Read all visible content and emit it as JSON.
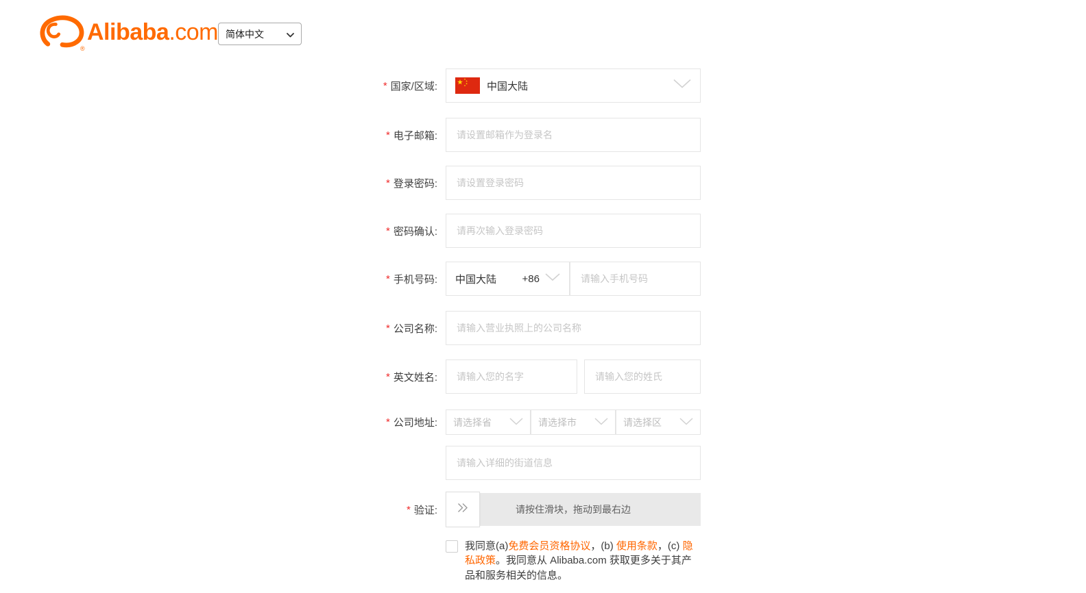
{
  "header": {
    "logo": {
      "brand": "Alibaba",
      "suffix": ".com",
      "registered_mark": "®"
    },
    "language_select": {
      "value": "简体中文"
    }
  },
  "form": {
    "required_marker": "*",
    "country": {
      "label": "国家/区域:",
      "value": "中国大陆"
    },
    "email": {
      "label": "电子邮箱:",
      "placeholder": "请设置邮箱作为登录名"
    },
    "password": {
      "label": "登录密码:",
      "placeholder": "请设置登录密码"
    },
    "password_confirm": {
      "label": "密码确认:",
      "placeholder": "请再次输入登录密码"
    },
    "phone": {
      "label": "手机号码:",
      "region": "中国大陆",
      "dial_code": "+86",
      "placeholder": "请输入手机号码"
    },
    "company_name": {
      "label": "公司名称:",
      "placeholder": "请输入营业执照上的公司名称"
    },
    "english_name": {
      "label": "英文姓名:",
      "first_name_placeholder": "请输入您的名字",
      "last_name_placeholder": "请输入您的姓氏"
    },
    "company_address": {
      "label": "公司地址:",
      "province_placeholder": "请选择省",
      "city_placeholder": "请选择市",
      "district_placeholder": "请选择区",
      "street_placeholder": "请输入详细的街道信息"
    },
    "captcha": {
      "label": "验证:",
      "instruction": "请按住滑块，拖动到最右边"
    },
    "agreement": {
      "part1": "我同意(a)",
      "membership_link": "免费会员资格协议",
      "part2": "，(b) ",
      "terms_link": "使用条款",
      "part3": "，(c) ",
      "privacy_link": "隐私政策",
      "part4": "。我同意从 Alibaba.com 获取更多关于其产品和服务相关的信息。"
    }
  },
  "icons": {
    "chevron_down": "⌄",
    "double_chevron_right": "»",
    "china_flag": "🇨🇳"
  },
  "colors": {
    "brand_orange": "#ff6a00",
    "link_orange": "#ff6600",
    "required_red": "#f02b2b",
    "input_border": "#e5e5e5",
    "placeholder_gray": "#c6c6c6",
    "label_gray": "#404040",
    "slider_track_gray": "#e9e9e9",
    "flag_red": "#de2910",
    "flag_yellow": "#ffde00"
  }
}
